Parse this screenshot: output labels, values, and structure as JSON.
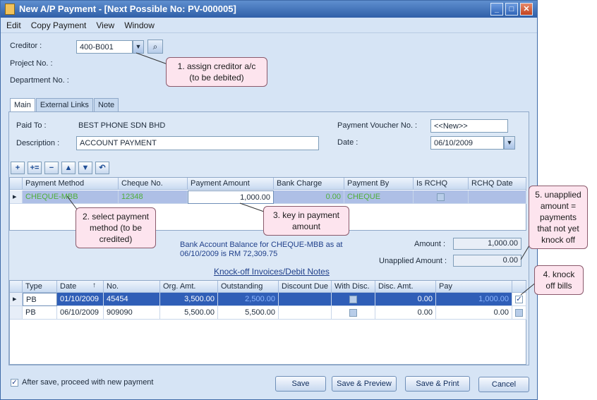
{
  "window": {
    "title": "New A/P Payment - [Next Possible No: PV-000005]",
    "min": "_",
    "max": "□",
    "close": "✕"
  },
  "menu": [
    "Edit",
    "Copy Payment",
    "View",
    "Window"
  ],
  "header": {
    "creditor_label": "Creditor :",
    "creditor_value": "400-B001",
    "project_label": "Project No. :",
    "department_label": "Department No. :"
  },
  "callouts": {
    "c1": "1. assign creditor a/c\n(to be debited)",
    "c2": "2. select payment method (to be credited)",
    "c3": "3. key in payment amount",
    "c4": "4. knock off bills",
    "c5": "5. unapplied amount = payments that not yet knock off"
  },
  "tabs": [
    "Main",
    "External Links",
    "Note"
  ],
  "main": {
    "paid_to_label": "Paid To :",
    "paid_to_value": "BEST PHONE SDN BHD",
    "description_label": "Description :",
    "description_value": "ACCOUNT PAYMENT",
    "pv_no_label": "Payment Voucher No. :",
    "pv_no_value": "<<New>>",
    "date_label": "Date :",
    "date_value": "06/10/2009"
  },
  "toolbar_icons": [
    "add-icon",
    "insert-icon",
    "delete-icon",
    "move-up-icon",
    "move-down-icon",
    "undo-icon"
  ],
  "toolbar_glyphs": [
    "+",
    "+=",
    "−",
    "▲",
    "▼",
    "↶"
  ],
  "payment_grid": {
    "columns": [
      "Payment Method",
      "Cheque No.",
      "Payment Amount",
      "Bank Charge",
      "Payment By",
      "Is RCHQ",
      "RCHQ Date"
    ],
    "row": {
      "method": "CHEQUE-MBB",
      "cheque_no": "12348",
      "amount": "1,000.00",
      "bank_charge": "0.00",
      "payment_by": "CHEQUE",
      "rchq_date": ""
    }
  },
  "balance_text": "Bank Account Balance for CHEQUE-MBB as at 06/10/2009 is RM 72,309.75",
  "amount_label": "Amount :",
  "amount_value": "1,000.00",
  "unapplied_label": "Unapplied Amount :",
  "unapplied_value": "0.00",
  "knockoff_title": "Knock-off Invoices/Debit Notes",
  "knockoff_grid": {
    "columns": [
      "Type",
      "Date",
      "No.",
      "Org. Amt.",
      "Outstanding",
      "Discount Due",
      "With Disc.",
      "Disc. Amt.",
      "Pay"
    ],
    "sort_glyph": "↑",
    "rows": [
      {
        "type": "PB",
        "date": "01/10/2009",
        "no": "45454",
        "org": "3,500.00",
        "outstanding": "2,500.00",
        "disc_due": "",
        "disc_amt": "0.00",
        "pay": "1,000.00",
        "checked": true
      },
      {
        "type": "PB",
        "date": "06/10/2009",
        "no": "909090",
        "org": "5,500.00",
        "outstanding": "5,500.00",
        "disc_due": "",
        "disc_amt": "0.00",
        "pay": "0.00",
        "checked": false
      }
    ]
  },
  "footer": {
    "after_save_label": "After save, proceed with new payment",
    "save": "Save",
    "save_preview": "Save & Preview",
    "save_print": "Save & Print",
    "cancel": "Cancel"
  }
}
